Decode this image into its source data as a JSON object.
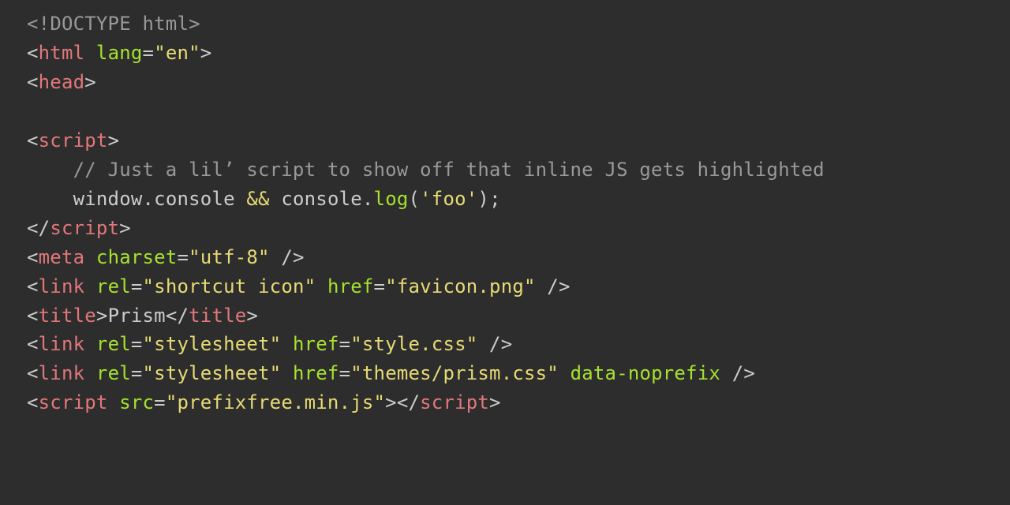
{
  "code": {
    "doctype": {
      "open": "<!",
      "name": "DOCTYPE html",
      "close": ">"
    },
    "htmlOpen": {
      "lt": "<",
      "tag": "html",
      "sp": " ",
      "attr": "lang",
      "eq": "=",
      "val": "\"en\"",
      "gt": ">"
    },
    "headOpen": {
      "lt": "<",
      "tag": "head",
      "gt": ">"
    },
    "blank": "",
    "scriptOpen": {
      "lt": "<",
      "tag": "script",
      "gt": ">"
    },
    "jsComment": "    // Just a lil’ script to show off that inline JS gets highlighted",
    "jsLine": {
      "indent": "    ",
      "w1": "window",
      "dot1": ".",
      "console1": "console",
      "sp1": " ",
      "amp": "&&",
      "sp2": " ",
      "console2": "console",
      "dot2": ".",
      "log": "log",
      "lp": "(",
      "arg": "'foo'",
      "rp": ")",
      "semi": ";"
    },
    "scriptClose": {
      "lt": "<",
      "sl": "/",
      "tag": "script",
      "gt": ">"
    },
    "meta": {
      "lt": "<",
      "tag": "meta",
      "sp": " ",
      "attr": "charset",
      "eq": "=",
      "val": "\"utf-8\"",
      "end": " />"
    },
    "link1": {
      "lt": "<",
      "tag": "link",
      "sp1": " ",
      "a1": "rel",
      "eq1": "=",
      "v1": "\"shortcut icon\"",
      "sp2": " ",
      "a2": "href",
      "eq2": "=",
      "v2": "\"favicon.png\"",
      "end": " />"
    },
    "titleOpen": {
      "lt": "<",
      "tag": "title",
      "gt": ">"
    },
    "titleText": "Prism",
    "titleClose": {
      "lt": "<",
      "sl": "/",
      "tag": "title",
      "gt": ">"
    },
    "link2": {
      "lt": "<",
      "tag": "link",
      "sp1": " ",
      "a1": "rel",
      "eq1": "=",
      "v1": "\"stylesheet\"",
      "sp2": " ",
      "a2": "href",
      "eq2": "=",
      "v2": "\"style.css\"",
      "end": " />"
    },
    "link3": {
      "lt": "<",
      "tag": "link",
      "sp1": " ",
      "a1": "rel",
      "eq1": "=",
      "v1": "\"stylesheet\"",
      "sp2": " ",
      "a2": "href",
      "eq2": "=",
      "v2": "\"themes/prism.css\"",
      "sp3": " ",
      "a3": "data-noprefix",
      "end": " />"
    },
    "script2Open": {
      "lt": "<",
      "tag": "script",
      "sp": " ",
      "attr": "src",
      "eq": "=",
      "val": "\"prefixfree.min.js\"",
      "gt": ">"
    },
    "script2Close": {
      "lt": "<",
      "sl": "/",
      "tag": "script",
      "gt": ">"
    }
  }
}
